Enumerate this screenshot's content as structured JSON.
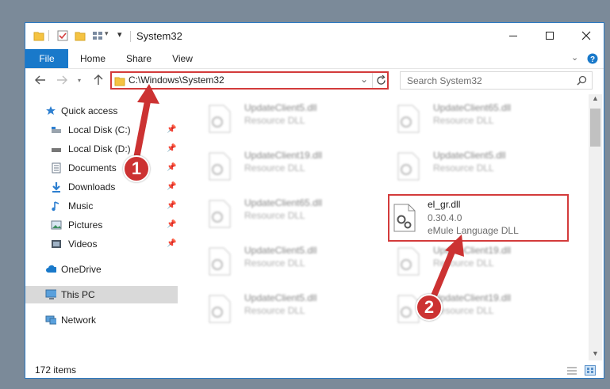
{
  "window": {
    "title": "System32",
    "controls": [
      "minimize-icon",
      "maximize-icon",
      "close-icon"
    ]
  },
  "ribbon": {
    "tabs": [
      "File",
      "Home",
      "Share",
      "View"
    ],
    "accent": "#1979ca"
  },
  "nav": {
    "address": "C:\\Windows\\System32",
    "search_placeholder": "Search System32"
  },
  "sidebar": {
    "items": [
      {
        "label": "Quick access",
        "icon": "star-icon"
      },
      {
        "label": "Local Disk (C:)",
        "icon": "drive-icon",
        "pinned": true
      },
      {
        "label": "Local Disk (D:)",
        "icon": "drive-icon",
        "pinned": true
      },
      {
        "label": "Documents",
        "icon": "documents-icon",
        "pinned": true
      },
      {
        "label": "Downloads",
        "icon": "download-icon",
        "pinned": true
      },
      {
        "label": "Music",
        "icon": "music-icon",
        "pinned": true
      },
      {
        "label": "Pictures",
        "icon": "pictures-icon",
        "pinned": true
      },
      {
        "label": "Videos",
        "icon": "videos-icon",
        "pinned": true
      },
      {
        "label": "OneDrive",
        "icon": "cloud-icon"
      },
      {
        "label": "This PC",
        "icon": "computer-icon",
        "selected": true
      },
      {
        "label": "Network",
        "icon": "network-icon"
      }
    ]
  },
  "files": [
    {
      "name": "UpdateClient5.dll",
      "desc": "Resource DLL"
    },
    {
      "name": "UpdateClient65.dll",
      "desc": "Resource DLL"
    },
    {
      "name": "UpdateClient19.dll",
      "desc": "Resource DLL"
    },
    {
      "name": "UpdateClient5.dll",
      "desc": "Resource DLL"
    },
    {
      "name": "UpdateClient65.dll",
      "desc": "Resource DLL"
    },
    {
      "name": "el_gr.dll",
      "version": "0.30.4.0",
      "desc": "eMule Language DLL"
    },
    {
      "name": "UpdateClient5.dll",
      "desc": "Resource DLL"
    },
    {
      "name": "UpdateClient19.dll",
      "desc": "Resource DLL"
    },
    {
      "name": "UpdateClient5.dll",
      "desc": "Resource DLL"
    },
    {
      "name": "UpdateClient19.dll",
      "desc": "Resource DLL"
    }
  ],
  "status": {
    "item_count": "172 items"
  },
  "annotations": {
    "marker1": "1",
    "marker2": "2",
    "color": "#cc3232"
  }
}
